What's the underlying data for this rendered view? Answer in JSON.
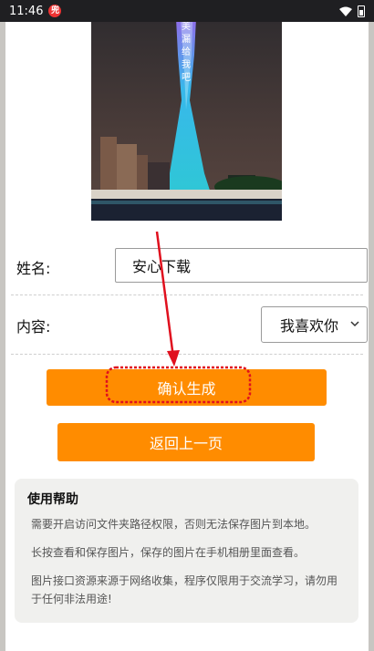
{
  "status_bar": {
    "time": "11:46",
    "app_badge": "兜",
    "icons": [
      "notification-badge-icon",
      "wifi-icon",
      "battery-icon"
    ]
  },
  "preview": {
    "overlay_text": "美 漏 给 我 吧",
    "colors": {
      "sky": "#3b3435",
      "tower": "#37c6ff",
      "tower_top": "#b65cff",
      "water": "#1b2232"
    }
  },
  "form": {
    "name_label": "姓名:",
    "name_value": "安心下载",
    "content_label": "内容:",
    "content_selected": "我喜欢你"
  },
  "buttons": {
    "confirm": "确认生成",
    "back": "返回上一页"
  },
  "help": {
    "title": "使用帮助",
    "items": [
      "需要开启访问文件夹路径权限，否则无法保存图片到本地。",
      "长按查看和保存图片，保存的图片在手机相册里面查看。",
      "图片接口资源来源于网络收集，程序仅限用于交流学习，请勿用于任何非法用途!"
    ]
  },
  "colors": {
    "accent": "#ff8c00",
    "annotation": "#e0101e"
  }
}
